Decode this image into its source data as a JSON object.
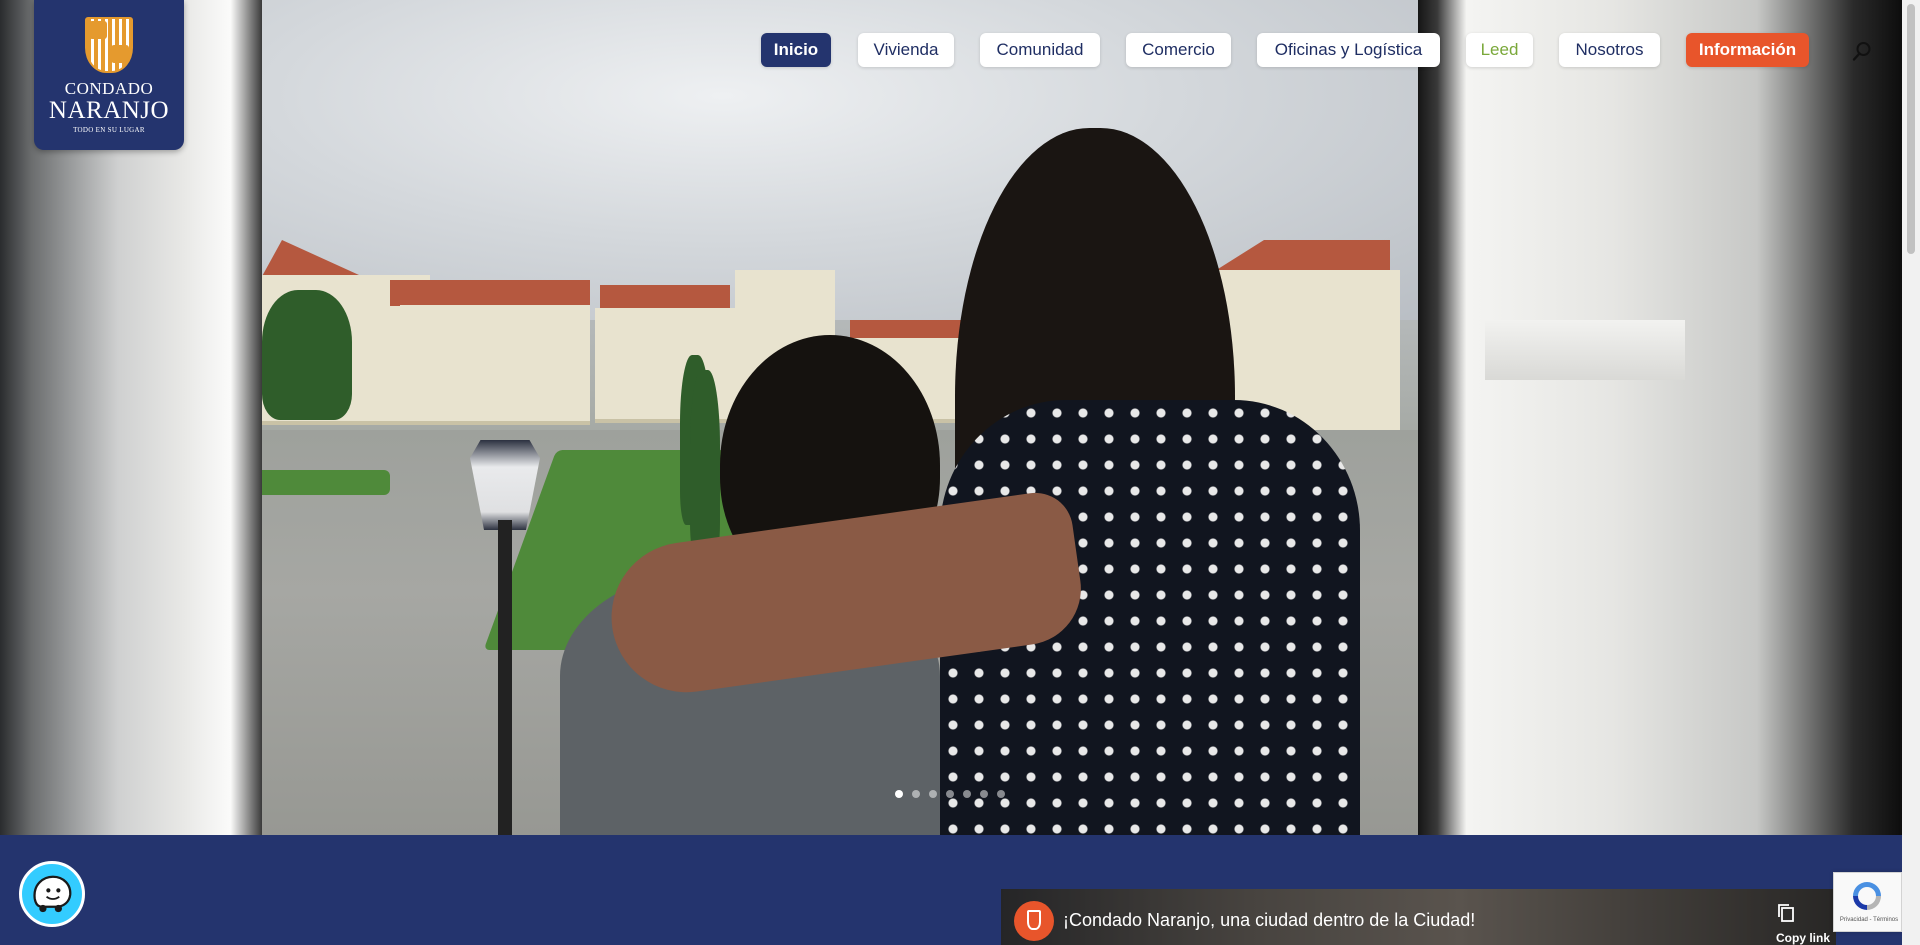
{
  "logo": {
    "line1": "CONDADO",
    "line2": "NARANJO",
    "tagline": "TODO EN SU LUGAR"
  },
  "nav": {
    "items": [
      {
        "label": "Inicio",
        "state": "active"
      },
      {
        "label": "Vivienda",
        "state": "default"
      },
      {
        "label": "Comunidad",
        "state": "default"
      },
      {
        "label": "Comercio",
        "state": "default"
      },
      {
        "label": "Oficinas y Logística",
        "state": "default"
      },
      {
        "label": "Leed",
        "state": "leed"
      },
      {
        "label": "Nosotros",
        "state": "default"
      },
      {
        "label": "Información",
        "state": "cta"
      }
    ],
    "search_icon": "search-icon"
  },
  "slider": {
    "slide_count": 7,
    "active_index": 0
  },
  "video": {
    "title": "¡Condado Naranjo, una ciudad dentro de la Ciudad!",
    "copy_label": "Copy link"
  },
  "recaptcha": {
    "footer": "Privacidad - Términos"
  },
  "colors": {
    "brand_blue": "#24346e",
    "cta_orange": "#e8552b",
    "leed_green": "#7aa83a",
    "logo_gold": "#e59a2e"
  }
}
